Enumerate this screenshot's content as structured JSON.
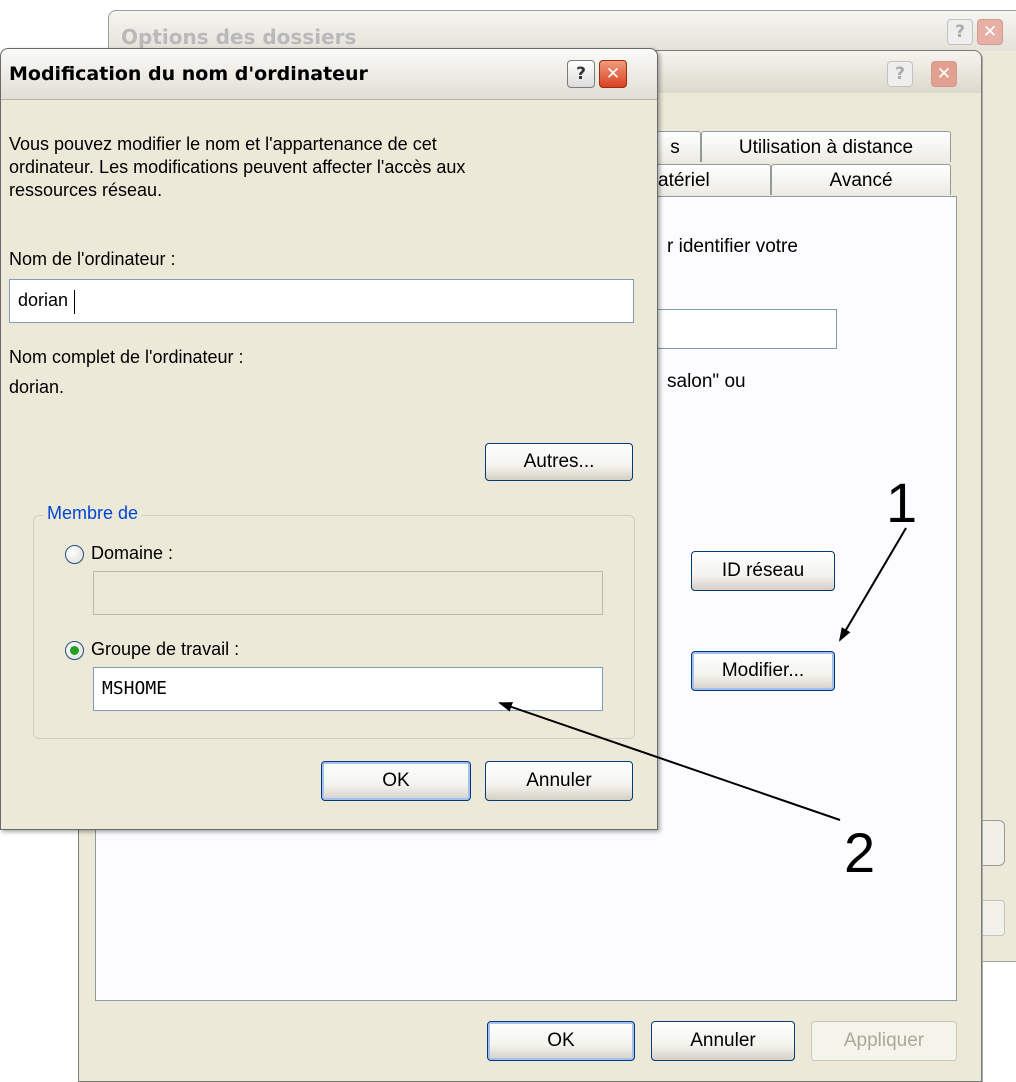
{
  "window_folder_options": {
    "title": "Options des dossiers",
    "help_label": "?",
    "close_label": "✕"
  },
  "window_system_properties": {
    "help_label": "?",
    "close_label": "✕",
    "tabs_row1": [
      "s",
      "Utilisation à distance"
    ],
    "tabs_row2": [
      "atériel",
      "Avancé"
    ],
    "partial_text_1": "r identifier votre",
    "partial_text_2": "salon\" ou",
    "network_id_button": "ID réseau",
    "modify_button": "Modifier...",
    "ok_button": "OK",
    "cancel_button": "Annuler",
    "apply_button": "Appliquer"
  },
  "dialog_rename": {
    "title": "Modification du nom d'ordinateur",
    "help_label": "?",
    "close_label": "✕",
    "description": "Vous pouvez modifier le nom et l'appartenance de cet ordinateur. Les modifications peuvent affecter l'accès aux ressources réseau.",
    "description_lines": [
      "Vous pouvez modifier le nom et l'appartenance de cet",
      "ordinateur. Les modifications peuvent affecter l'accès aux",
      "ressources réseau."
    ],
    "computer_name_label": "Nom de l'ordinateur :",
    "computer_name_value": "dorian",
    "full_name_label": "Nom complet de l'ordinateur :",
    "full_name_value": "dorian.",
    "more_button": "Autres...",
    "member_of_legend": "Membre de",
    "domain_label": "Domaine :",
    "domain_value": "",
    "domain_selected": false,
    "workgroup_label": "Groupe de travail :",
    "workgroup_value": "MSHOME",
    "workgroup_selected": true,
    "ok_button": "OK",
    "cancel_button": "Annuler"
  },
  "annotations": {
    "label_1": "1",
    "label_2": "2"
  }
}
